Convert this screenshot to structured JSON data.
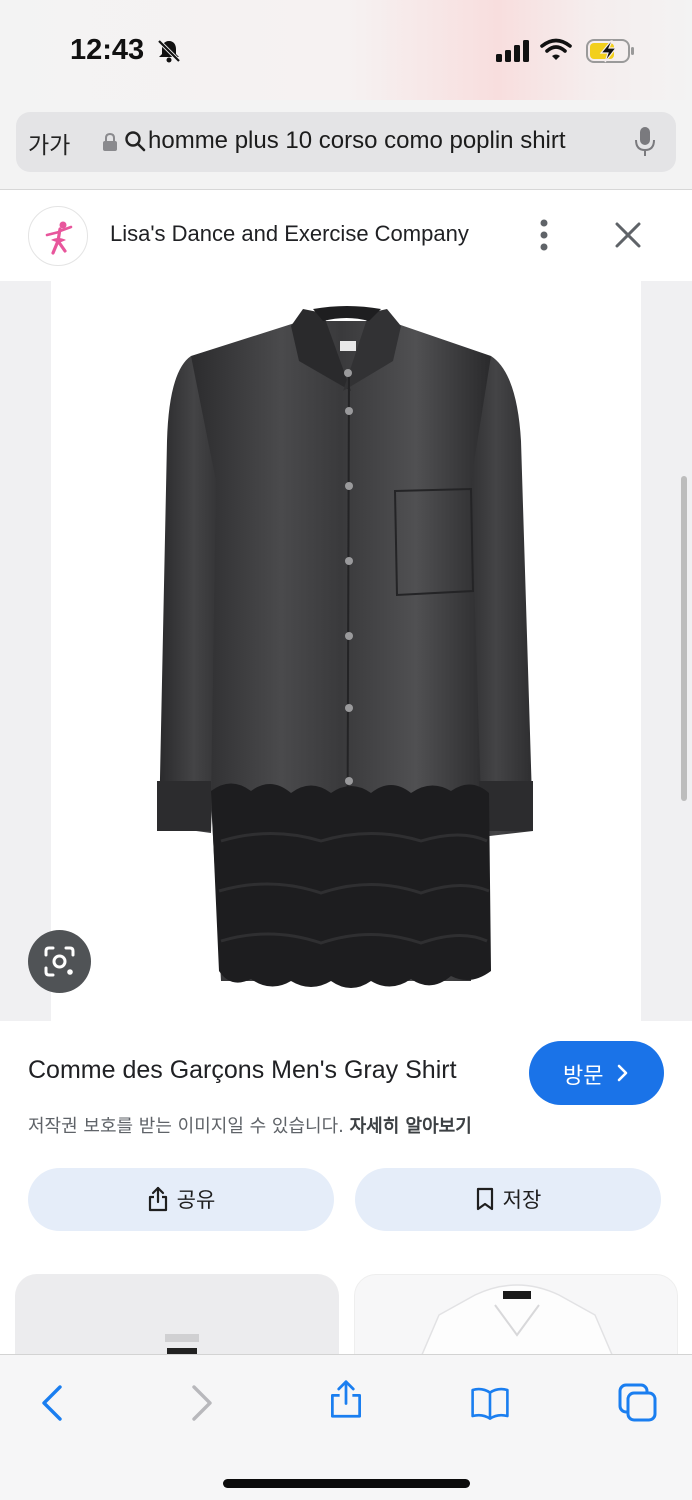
{
  "status_bar": {
    "time": "12:43"
  },
  "url_bar": {
    "text_size_label": "가가",
    "query": "homme plus 10 corso como poplin shirt"
  },
  "source": {
    "site_name": "Lisa's Dance and Exercise Company"
  },
  "product": {
    "title": "Comme des Garçons Men's Gray Shirt",
    "visit_label": "방문",
    "copyright_notice": "저작권 보호를 받는 이미지일 수 있습니다.",
    "learn_more_label": "자세히 알아보기"
  },
  "actions": {
    "share_label": "공유",
    "save_label": "저장"
  },
  "colors": {
    "accent": "#1a73e8",
    "action_bg": "#e5edf9",
    "toolbar_icon": "#1a7ef0"
  },
  "icons": [
    "bell-slash-icon",
    "signal-icon",
    "wifi-icon",
    "battery-charging-icon",
    "lock-icon",
    "search-icon",
    "mic-icon",
    "more-vert-icon",
    "close-icon",
    "lens-icon",
    "chevron-right-icon",
    "share-icon",
    "bookmark-icon",
    "back-icon",
    "forward-icon",
    "book-icon",
    "tabs-icon"
  ]
}
